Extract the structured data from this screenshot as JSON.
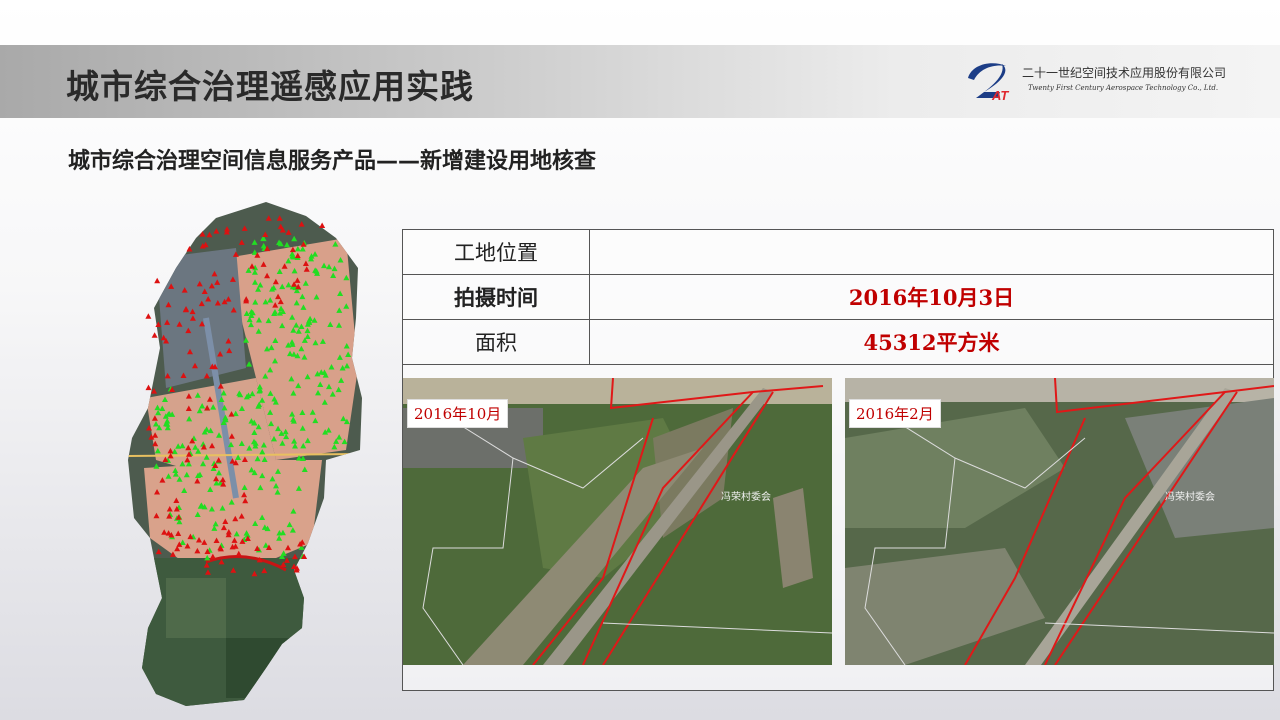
{
  "slide": {
    "title": "城市综合治理遥感应用实践",
    "subtitle": "城市综合治理空间信息服务产品——新增建设用地核查"
  },
  "company": {
    "name_cn": "二十一世纪空间技术应用股份有限公司",
    "name_en": "Twenty First Century Aerospace Technology Co., Ltd.",
    "logo_text": "AT"
  },
  "info_table": {
    "rows": [
      {
        "label": "工地位置",
        "value": ""
      },
      {
        "label": "拍摄时间",
        "value": "2016年10月3日"
      },
      {
        "label": "面积",
        "value": "45312平方米"
      }
    ]
  },
  "photos": [
    {
      "tag": "2016年10月",
      "place_label": "冯荣村委会"
    },
    {
      "tag": "2016年2月",
      "place_label": "冯荣村委会"
    }
  ],
  "colors": {
    "value_text": "#c00000",
    "parcel_outline": "#e01818",
    "marker_green": "#22dd22",
    "marker_red": "#dd1111",
    "map_parcel": "#d9a089"
  }
}
